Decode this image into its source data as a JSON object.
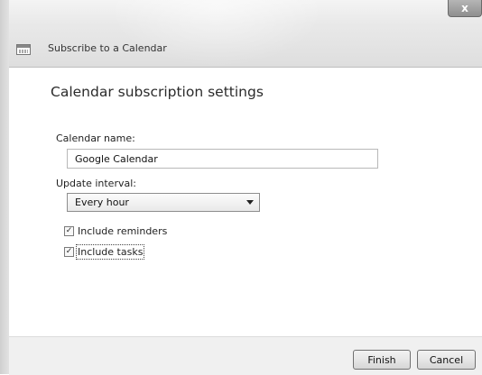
{
  "window": {
    "title": "Subscribe to a Calendar",
    "close_glyph": "x",
    "icon": "calendar-icon"
  },
  "form": {
    "heading": "Calendar subscription settings",
    "calendar_name_label": "Calendar name:",
    "calendar_name_value": "Google Calendar",
    "update_interval_label": "Update interval:",
    "update_interval_value": "Every hour",
    "include_reminders_label": "Include reminders",
    "include_reminders_checked": true,
    "include_tasks_label": "Include tasks",
    "include_tasks_checked": true
  },
  "footer": {
    "finish_label": "Finish",
    "cancel_label": "Cancel"
  }
}
